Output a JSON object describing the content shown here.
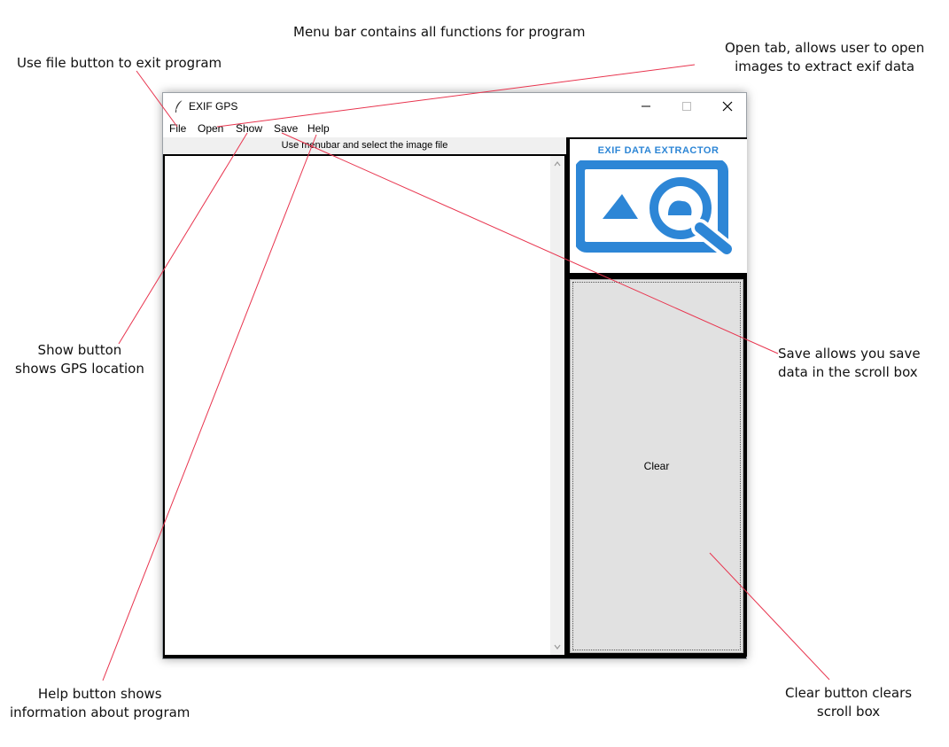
{
  "annotations": {
    "menu_bar": "Menu bar contains all functions for program",
    "file_line1": "Use file button to exit program",
    "open_line1": "Open tab, allows user to open",
    "open_line2": "images to extract exif data",
    "show_line1": "Show button",
    "show_line2": "shows GPS location",
    "save_line1": "Save allows you save",
    "save_line2": "data in the scroll box",
    "help_line1": "Help button shows",
    "help_line2": "information about program",
    "clear_line1": "Clear button clears",
    "clear_line2": "scroll box"
  },
  "window": {
    "title": "EXIF GPS",
    "menu": [
      "File",
      "Open",
      "Show",
      "Save",
      "Help"
    ],
    "status_text": "Use menubar and select the image file",
    "logo_text": "EXIF DATA EXTRACTOR",
    "clear_label": "Clear"
  },
  "colors": {
    "callout_line": "#e8344e",
    "logo_blue": "#2d86d6",
    "button_face": "#e1e1e1"
  },
  "icons": [
    "feather-icon",
    "minimize-icon",
    "maximize-icon",
    "close-icon",
    "scroll-up-icon",
    "scroll-down-icon",
    "image-search-logo"
  ]
}
